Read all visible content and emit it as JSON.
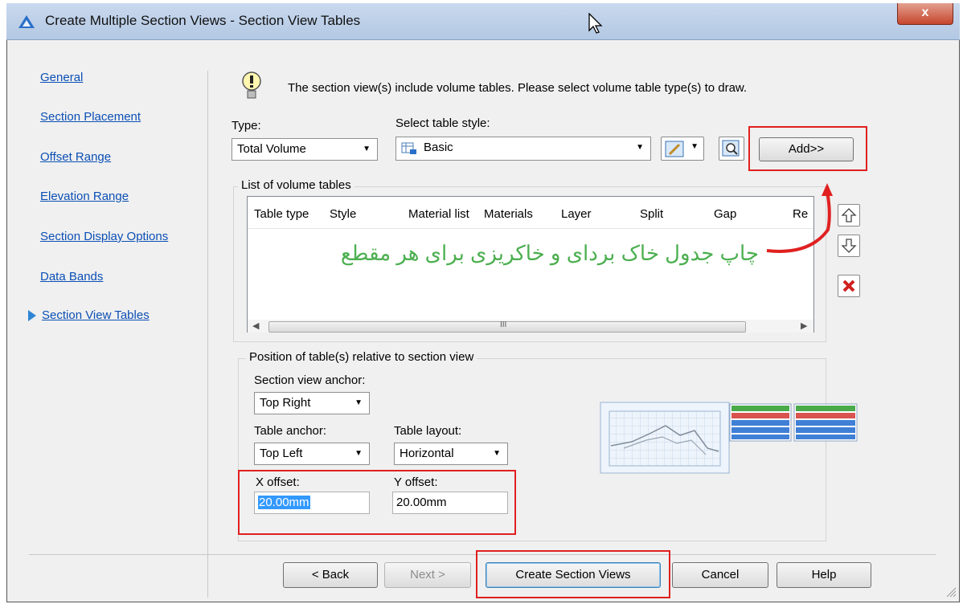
{
  "window": {
    "title": "Create Multiple Section Views - Section View Tables",
    "close_label": "x"
  },
  "sidebar": {
    "items": [
      {
        "label": "General"
      },
      {
        "label": "Section Placement"
      },
      {
        "label": "Offset Range"
      },
      {
        "label": "Elevation Range"
      },
      {
        "label": "Section Display Options"
      },
      {
        "label": "Data Bands"
      },
      {
        "label": "Section View Tables",
        "current": true
      }
    ]
  },
  "main": {
    "info_text": "The section view(s) include volume tables. Please select volume table type(s) to draw.",
    "type_label": "Type:",
    "type_value": "Total Volume",
    "style_label": "Select table style:",
    "style_value": "Basic",
    "add_button": "Add>>",
    "list": {
      "title": "List of volume tables",
      "columns": [
        "Table type",
        "Style",
        "Material list",
        "Materials",
        "Layer",
        "Split",
        "Gap",
        "Re"
      ],
      "scroll_thumb_glyph": "III"
    },
    "annotation": {
      "text": "چاپ جدول خاک بردای و خاکریزی برای هر مقطع",
      "color": "#4caf50",
      "arrow_color": "#e02020"
    },
    "position": {
      "title": "Position of table(s) relative to section view",
      "section_anchor_label": "Section view anchor:",
      "section_anchor_value": "Top Right",
      "table_anchor_label": "Table anchor:",
      "table_anchor_value": "Top Left",
      "table_layout_label": "Table layout:",
      "table_layout_value": "Horizontal",
      "x_offset_label": "X offset:",
      "x_offset_value": "20.00mm",
      "y_offset_label": "Y offset:",
      "y_offset_value": "20.00mm"
    }
  },
  "footer": {
    "back": "< Back",
    "next": "Next >",
    "create": "Create Section Views",
    "cancel": "Cancel",
    "help": "Help"
  },
  "colors": {
    "highlight_box": "#e02020",
    "link": "#0b4fb5",
    "selection": "#3399ff"
  }
}
